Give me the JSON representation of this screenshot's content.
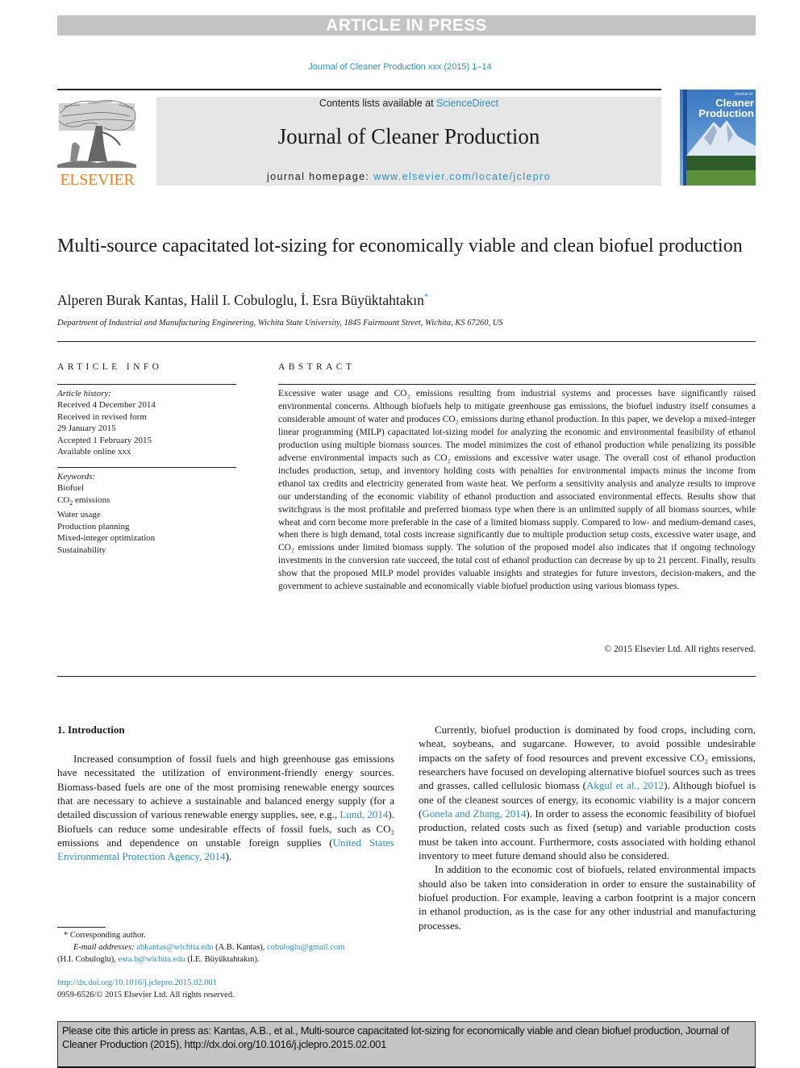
{
  "banner": {
    "text": "ARTICLE IN PRESS"
  },
  "journal_ref": "Journal of Cleaner Production xxx (2015) 1–14",
  "header": {
    "publisher_logo_text": "ELSEVIER",
    "contents_prefix": "Contents lists available at ",
    "contents_link": "ScienceDirect",
    "journal_title": "Journal of Cleaner Production",
    "homepage_prefix": "journal homepage: ",
    "homepage_link": "www.elsevier.com/locate/jclepro",
    "cover": {
      "small_title": "Journal of",
      "title_line1": "Cleaner",
      "title_line2": "Production"
    }
  },
  "article": {
    "title": "Multi-source capacitated lot-sizing for economically viable and clean biofuel production",
    "authors": "Alperen Burak Kantas, Halil I. Cobuloglu, İ. Esra Büyüktahtakın",
    "corresponding_mark": "*",
    "affiliation": "Department of Industrial and Manufacturing Engineering, Wichita State University, 1845 Fairmount Street, Wichita, KS 67260, US"
  },
  "article_info": {
    "heading": "ARTICLE INFO",
    "history_label": "Article history:",
    "history": [
      "Received 4 December 2014",
      "Received in revised form",
      "29 January 2015",
      "Accepted 1 February 2015",
      "Available online xxx"
    ],
    "keywords_label": "Keywords:",
    "keywords": [
      "Biofuel",
      "CO2 emissions",
      "Water usage",
      "Production planning",
      "Mixed-integer optimization",
      "Sustainability"
    ]
  },
  "abstract": {
    "heading": "ABSTRACT",
    "text": "Excessive water usage and CO₂ emissions resulting from industrial systems and processes have significantly raised environmental concerns. Although biofuels help to mitigate greenhouse gas emissions, the biofuel industry itself consumes a considerable amount of water and produces CO₂ emissions during ethanol production. In this paper, we develop a mixed-integer linear programming (MILP) capacitated lot-sizing model for analyzing the economic and environmental feasibility of ethanol production using multiple biomass sources. The model minimizes the cost of ethanol production while penalizing its possible adverse environmental impacts such as CO₂ emissions and excessive water usage. The overall cost of ethanol production includes production, setup, and inventory holding costs with penalties for environmental impacts minus the income from ethanol tax credits and electricity generated from waste heat. We perform a sensitivity analysis and analyze results to improve our understanding of the economic viability of ethanol production and associated environmental effects. Results show that switchgrass is the most profitable and preferred biomass type when there is an unlimited supply of all biomass sources, while wheat and corn become more preferable in the case of a limited biomass supply. Compared to low- and medium-demand cases, when there is high demand, total costs increase significantly due to multiple production setup costs, excessive water usage, and CO₂ emissions under limited biomass supply. The solution of the proposed model also indicates that if ongoing technology investments in the conversion rate succeed, the total cost of ethanol production can decrease by up to 21 percent. Finally, results show that the proposed MILP model provides valuable insights and strategies for future investors, decision-makers, and the government to achieve sustainable and economically viable biofuel production using various biomass types.",
    "copyright": "© 2015 Elsevier Ltd. All rights reserved."
  },
  "introduction": {
    "heading": "1.  Introduction",
    "p1": {
      "a": "Increased consumption of fossil fuels and high greenhouse gas emissions have necessitated the utilization of environment-friendly energy sources. Biomass-based fuels are one of the most promising renewable energy sources that are necessary to achieve a sustainable and balanced energy supply (for a detailed discussion of various renewable energy supplies, see, e.g., ",
      "link1": "Lund, 2014",
      "b": "). Biofuels can reduce some undesirable effects of fossil fuels, such as CO₂ emissions and dependence on unstable foreign supplies (",
      "link2": "United States Environmental Protection Agency, 2014",
      "c": ")."
    },
    "p2": {
      "a": "Currently, biofuel production is dominated by food crops, including corn, wheat, soybeans, and sugarcane. However, to avoid possible undesirable impacts on the safety of food resources and prevent excessive CO₂ emissions, researchers have focused on developing alternative biofuel sources such as trees and grasses, called cellulosic biomass (",
      "link1": "Akgul et al., 2012",
      "b": "). Although biofuel is one of the cleanest sources of energy, its economic viability is a major concern (",
      "link2": "Gonela and Zhang, 2014",
      "c": "). In order to assess the economic feasibility of biofuel production, related costs such as fixed (setup) and variable production costs must be taken into account. Furthermore, costs associated with holding ethanol inventory to meet future demand should also be considered."
    },
    "p3": "In addition to the economic cost of biofuels, related environmental impacts should also be taken into consideration in order to ensure the sustainability of biofuel production. For example, leaving a carbon footprint is a major concern in ethanol production, as is the case for any other industrial and manufacturing processes."
  },
  "footnote": {
    "corresponding": "* Corresponding author.",
    "email_label": "E-mail addresses:",
    "email1": "abkantas@wichita.edu",
    "email1_name": " (A.B. Kantas), ",
    "email2": "cobuloglu@gmail.com",
    "email2_name": "(H.I. Cobuloglu), ",
    "email3": "esra.b@wichita.edu",
    "email3_name": " (İ.E. Büyüktahtakın)."
  },
  "doi": {
    "link": "http://dx.doi.org/10.1016/j.jclepro.2015.02.001",
    "issn": "0959-6526/© 2015 Elsevier Ltd. All rights reserved."
  },
  "citation_box": {
    "text": "Please cite this article in press as: Kantas, A.B., et al., Multi-source capacitated lot-sizing for economically viable and clean biofuel production, Journal of Cleaner Production (2015), http://dx.doi.org/10.1016/j.jclepro.2015.02.001"
  },
  "colors": {
    "link": "#2a8fbf",
    "elsevier_orange": "#f07f1a",
    "banner_gray": "#c4c4c4",
    "header_gray": "#e6e6e6"
  }
}
